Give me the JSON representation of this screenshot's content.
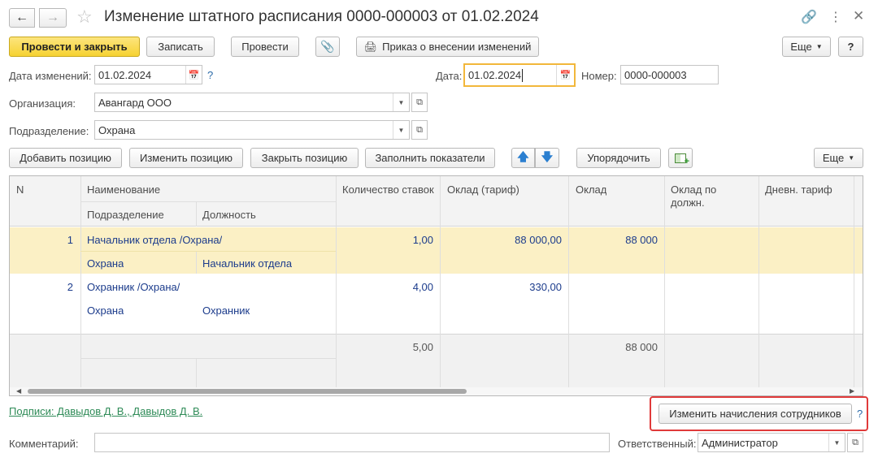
{
  "window": {
    "title": "Изменение штатного расписания 0000-000003 от 01.02.2024"
  },
  "toolbar": {
    "post_close": "Провести и закрыть",
    "write": "Записать",
    "post": "Провести",
    "order": "Приказ о внесении изменений",
    "more": "Еще",
    "help": "?"
  },
  "form": {
    "change_date_label": "Дата изменений:",
    "change_date_value": "01.02.2024",
    "date_label": "Дата:",
    "date_value": "01.02.2024",
    "number_label": "Номер:",
    "number_value": "0000-000003",
    "org_label": "Организация:",
    "org_value": "Авангард ООО",
    "dept_label": "Подразделение:",
    "dept_value": "Охрана"
  },
  "table_toolbar": {
    "add": "Добавить позицию",
    "edit": "Изменить позицию",
    "close": "Закрыть позицию",
    "fill": "Заполнить показатели",
    "sort": "Упорядочить",
    "more": "Еще"
  },
  "table": {
    "headers": {
      "n": "N",
      "name": "Наименование",
      "dept": "Подразделение",
      "position": "Должность",
      "rates": "Количество ставок",
      "salary_tariff": "Оклад (тариф)",
      "salary": "Оклад",
      "salary_by_pos_1": "Оклад по",
      "salary_by_pos_2": "должн.",
      "daily_tariff": "Дневн. тариф"
    },
    "rows": [
      {
        "n": "1",
        "name": "Начальник отдела /Охрана/",
        "dept": "Охрана",
        "position": "Начальник отдела",
        "rates": "1,00",
        "salary_tariff": "88 000,00",
        "salary": "88 000"
      },
      {
        "n": "2",
        "name": "Охранник /Охрана/",
        "dept": "Охрана",
        "position": "Охранник",
        "rates": "4,00",
        "salary_tariff": "330,00",
        "salary": ""
      }
    ],
    "totals": {
      "rates": "5,00",
      "salary": "88 000"
    }
  },
  "footer": {
    "signatures": "Подписи: Давыдов Д. В., Давыдов Д. В.",
    "change_accruals": "Изменить начисления сотрудников",
    "help": "?",
    "comment_label": "Комментарий:",
    "comment_value": "",
    "responsible_label": "Ответственный:",
    "responsible_value": "Администратор"
  },
  "colors": {
    "accent_yellow": "#f6d232",
    "selected_row": "#fbf0c5",
    "highlight_frame": "#e03a3a",
    "link_green": "#2e8b57"
  }
}
